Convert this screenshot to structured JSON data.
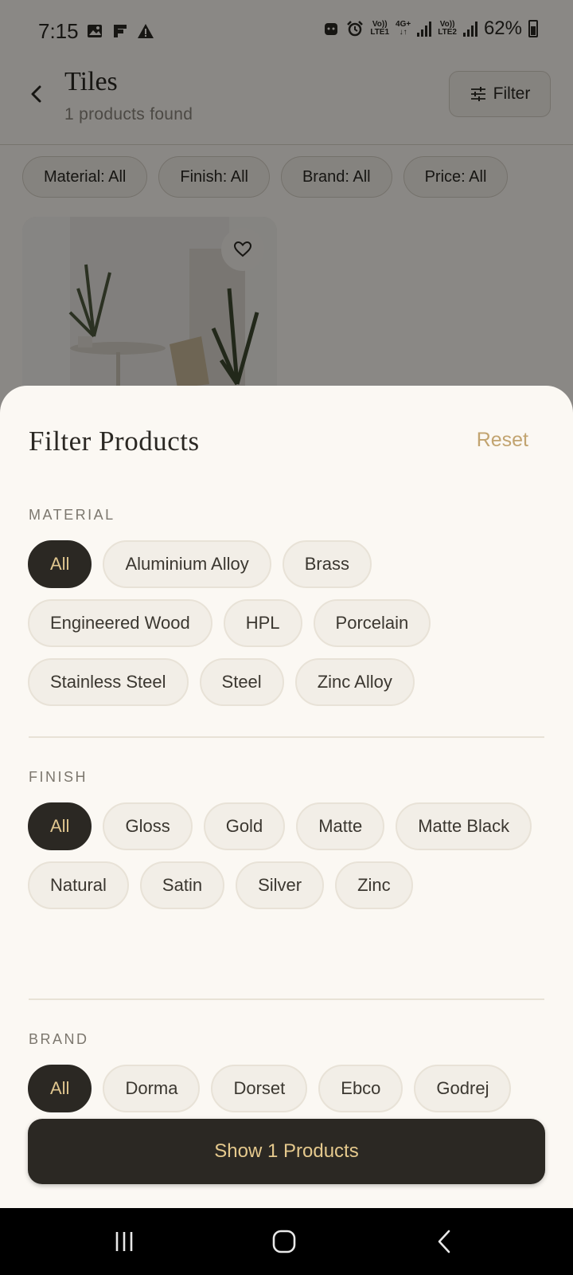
{
  "status_bar": {
    "time": "7:15",
    "battery": "62%",
    "net1_top": "Vo))",
    "net1_bottom": "LTE1",
    "net2_top": "4G+",
    "net2_bottom": "↓↑",
    "net3_top": "Vo))",
    "net3_bottom": "LTE2"
  },
  "header": {
    "title": "Tiles",
    "subtitle": "1 products found",
    "filter_label": "Filter"
  },
  "top_chips": [
    "Material: All",
    "Finish: All",
    "Brand: All",
    "Price: All"
  ],
  "sheet": {
    "title": "Filter Products",
    "reset_label": "Reset",
    "material": {
      "label": "MATERIAL",
      "options": [
        "All",
        "Aluminium Alloy",
        "Brass",
        "Engineered Wood",
        "HPL",
        "Porcelain",
        "Stainless Steel",
        "Steel",
        "Zinc Alloy"
      ],
      "selected": "All"
    },
    "finish": {
      "label": "FINISH",
      "options": [
        "All",
        "Gloss",
        "Gold",
        "Matte",
        "Matte Black",
        "Natural",
        "Satin",
        "Silver",
        "Zinc"
      ],
      "selected": "All"
    },
    "brand": {
      "label": "BRAND",
      "options": [
        "All",
        "Dorma",
        "Dorset",
        "Ebco",
        "Godrej"
      ],
      "selected": "All"
    },
    "show_button_label": "Show 1 Products"
  },
  "colors": {
    "accent": "#c2a470",
    "dark": "#2b2823",
    "background": "#fbf8f3"
  },
  "icons": [
    "back-arrow-icon",
    "filter-sliders-icon",
    "heart-icon",
    "nav-recents-icon",
    "nav-home-icon",
    "nav-back-icon"
  ]
}
